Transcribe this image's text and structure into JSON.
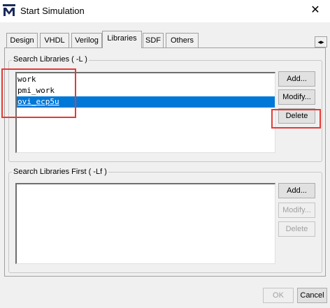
{
  "window": {
    "title": "Start Simulation",
    "close_glyph": "✕",
    "app_icon": "modelsim-m-icon"
  },
  "tabs": [
    {
      "label": "Design",
      "active": false
    },
    {
      "label": "VHDL",
      "active": false
    },
    {
      "label": "Verilog",
      "active": false
    },
    {
      "label": "Libraries",
      "active": true
    },
    {
      "label": "SDF",
      "active": false
    },
    {
      "label": "Others",
      "active": false
    }
  ],
  "tab_scroll_glyph": "◂▸",
  "search_libraries": {
    "label": "Search Libraries ( -L )",
    "items": [
      "work",
      "pmi_work",
      "ovi_ecp5u"
    ],
    "selected_index": 2,
    "buttons": {
      "add": "Add...",
      "modify": "Modify...",
      "delete": "Delete"
    }
  },
  "search_libraries_first": {
    "label": "Search Libraries First ( -Lf )",
    "items": [],
    "buttons": {
      "add": "Add...",
      "modify": "Modify...",
      "delete": "Delete"
    }
  },
  "footer": {
    "ok": "OK",
    "cancel": "Cancel"
  },
  "colors": {
    "selection": "#0078d7",
    "annotation": "#e53935"
  }
}
